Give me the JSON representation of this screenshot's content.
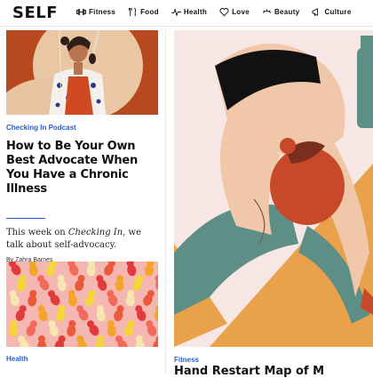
{
  "brand": {
    "logo": "SELF"
  },
  "nav": {
    "items": [
      {
        "label": "Fitness",
        "icon": "dumbbell-icon"
      },
      {
        "label": "Food",
        "icon": "fork-knife-icon"
      },
      {
        "label": "Health",
        "icon": "heartbeat-icon"
      },
      {
        "label": "Love",
        "icon": "heart-icon"
      },
      {
        "label": "Beauty",
        "icon": "eye-lashes-icon"
      },
      {
        "label": "Culture",
        "icon": "megaphone-icon"
      }
    ]
  },
  "articles": [
    {
      "kicker": "Checking In Podcast",
      "headline": "How to Be Your Own Best Advocate When You Have a Chronic Illness",
      "dek_prefix": "This week on ",
      "dek_emph": "Checking In",
      "dek_suffix": ", we talk about self-advocacy.",
      "byline": "By Zahra Barnes"
    },
    {
      "kicker": "Health"
    },
    {
      "kicker": "Fitness",
      "headline_visible": "Hand Restart Map of M"
    }
  ],
  "colors": {
    "accent": "#2a5ccf",
    "podcast_bg": "#b8491f",
    "candy_bg": "#f4b7b2",
    "stretch_bg": "#f6e6e4"
  }
}
